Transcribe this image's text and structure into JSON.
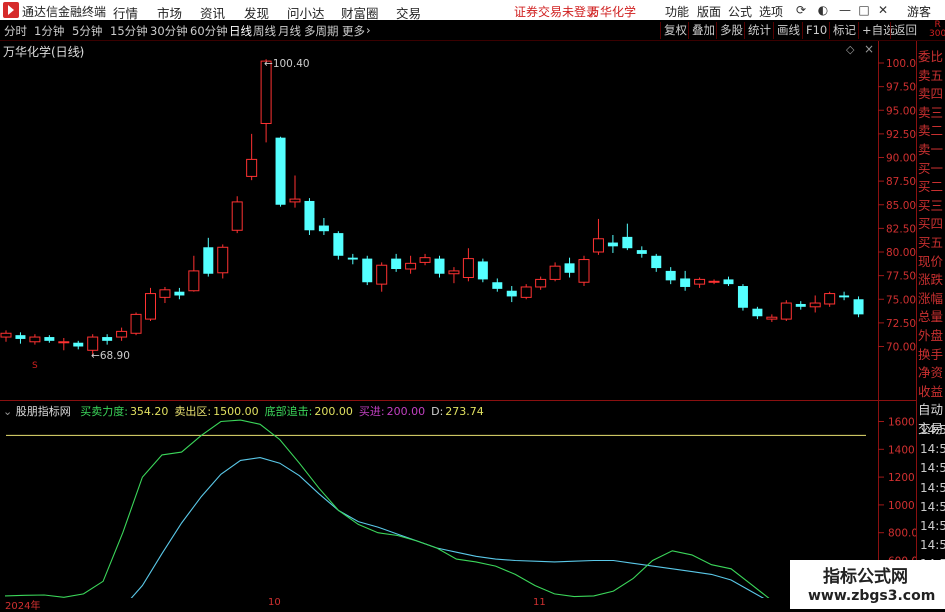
{
  "titlebar": {
    "app_name": "通达信金融终端",
    "menus": [
      "行情",
      "市场",
      "资讯",
      "发现",
      "问小达",
      "财富圈",
      "交易"
    ],
    "status": "证券交易未登录",
    "stock": "万华化学",
    "right_menus": [
      "功能",
      "版面",
      "公式",
      "选项"
    ],
    "user": "游客"
  },
  "toolbar": {
    "periods": [
      "分时",
      "1分钟",
      "5分钟",
      "15分钟",
      "30分钟",
      "60分钟",
      "日线",
      "周线",
      "月线",
      "多周期",
      "更多"
    ],
    "active_period": "日线",
    "right_buttons": [
      "复权",
      "叠加",
      "多股",
      "统计",
      "画线",
      "F10",
      "标记",
      "+自选",
      "返回"
    ]
  },
  "main_chart": {
    "title": "万华化学(日线)",
    "y_ticks": [
      "100.0",
      "97.50",
      "95.00",
      "92.50",
      "90.00",
      "87.50",
      "85.00",
      "82.50",
      "80.00",
      "77.50",
      "75.00",
      "72.50",
      "70.00"
    ],
    "high_label": "100.40",
    "low_label": "68.90",
    "marker": "S",
    "candles": [
      {
        "o": 71.0,
        "c": 71.4,
        "h": 71.7,
        "l": 70.5
      },
      {
        "o": 71.2,
        "c": 70.8,
        "h": 71.5,
        "l": 70.3
      },
      {
        "o": 70.5,
        "c": 71.0,
        "h": 71.3,
        "l": 70.2
      },
      {
        "o": 71.0,
        "c": 70.6,
        "h": 71.2,
        "l": 70.4
      },
      {
        "o": 70.4,
        "c": 70.5,
        "h": 70.9,
        "l": 69.6
      },
      {
        "o": 70.4,
        "c": 70.0,
        "h": 70.6,
        "l": 69.7
      },
      {
        "o": 69.6,
        "c": 71.0,
        "h": 71.3,
        "l": 68.9
      },
      {
        "o": 71.0,
        "c": 70.6,
        "h": 71.3,
        "l": 70.2
      },
      {
        "o": 71.0,
        "c": 71.6,
        "h": 72.0,
        "l": 70.6
      },
      {
        "o": 71.4,
        "c": 73.4,
        "h": 73.6,
        "l": 71.2
      },
      {
        "o": 72.9,
        "c": 75.6,
        "h": 76.2,
        "l": 72.7
      },
      {
        "o": 75.2,
        "c": 76.0,
        "h": 76.3,
        "l": 74.6
      },
      {
        "o": 75.8,
        "c": 75.4,
        "h": 76.2,
        "l": 75.0
      },
      {
        "o": 75.9,
        "c": 78.0,
        "h": 79.6,
        "l": 75.8
      },
      {
        "o": 80.5,
        "c": 77.7,
        "h": 81.5,
        "l": 77.4
      },
      {
        "o": 77.8,
        "c": 80.5,
        "h": 80.8,
        "l": 77.2
      },
      {
        "o": 82.3,
        "c": 85.3,
        "h": 85.9,
        "l": 82.0
      },
      {
        "o": 88.0,
        "c": 89.8,
        "h": 92.5,
        "l": 87.6
      },
      {
        "o": 93.6,
        "c": 100.2,
        "h": 100.4,
        "l": 91.6
      },
      {
        "o": 92.1,
        "c": 85.0,
        "h": 92.2,
        "l": 84.8
      },
      {
        "o": 85.3,
        "c": 85.6,
        "h": 88.1,
        "l": 84.7
      },
      {
        "o": 85.4,
        "c": 82.3,
        "h": 85.7,
        "l": 81.8
      },
      {
        "o": 82.8,
        "c": 82.2,
        "h": 83.6,
        "l": 81.8
      },
      {
        "o": 82.0,
        "c": 79.6,
        "h": 82.2,
        "l": 79.2
      },
      {
        "o": 79.4,
        "c": 79.2,
        "h": 79.8,
        "l": 78.7
      },
      {
        "o": 79.3,
        "c": 76.8,
        "h": 79.6,
        "l": 76.5
      },
      {
        "o": 76.6,
        "c": 78.6,
        "h": 78.9,
        "l": 75.8
      },
      {
        "o": 79.3,
        "c": 78.2,
        "h": 79.8,
        "l": 77.9
      },
      {
        "o": 78.2,
        "c": 78.8,
        "h": 79.6,
        "l": 77.7
      },
      {
        "o": 78.9,
        "c": 79.4,
        "h": 79.8,
        "l": 78.6
      },
      {
        "o": 79.3,
        "c": 77.7,
        "h": 79.6,
        "l": 77.3
      },
      {
        "o": 77.7,
        "c": 78.0,
        "h": 78.4,
        "l": 76.7
      },
      {
        "o": 77.3,
        "c": 79.3,
        "h": 80.4,
        "l": 76.9
      },
      {
        "o": 79.0,
        "c": 77.1,
        "h": 79.3,
        "l": 76.8
      },
      {
        "o": 76.8,
        "c": 76.1,
        "h": 77.2,
        "l": 75.8
      },
      {
        "o": 75.9,
        "c": 75.3,
        "h": 76.4,
        "l": 74.7
      },
      {
        "o": 75.2,
        "c": 76.3,
        "h": 76.6,
        "l": 75.0
      },
      {
        "o": 76.3,
        "c": 77.1,
        "h": 77.4,
        "l": 76.0
      },
      {
        "o": 77.1,
        "c": 78.5,
        "h": 78.9,
        "l": 76.9
      },
      {
        "o": 78.8,
        "c": 77.8,
        "h": 79.4,
        "l": 77.3
      },
      {
        "o": 76.8,
        "c": 79.2,
        "h": 79.6,
        "l": 76.4
      },
      {
        "o": 80.0,
        "c": 81.4,
        "h": 83.5,
        "l": 79.7
      },
      {
        "o": 81.0,
        "c": 80.6,
        "h": 81.8,
        "l": 79.9
      },
      {
        "o": 81.6,
        "c": 80.4,
        "h": 83.0,
        "l": 80.2
      },
      {
        "o": 80.2,
        "c": 79.8,
        "h": 80.6,
        "l": 79.4
      },
      {
        "o": 79.6,
        "c": 78.3,
        "h": 79.8,
        "l": 77.9
      },
      {
        "o": 78.0,
        "c": 77.0,
        "h": 78.4,
        "l": 76.6
      },
      {
        "o": 77.2,
        "c": 76.3,
        "h": 78.0,
        "l": 75.9
      },
      {
        "o": 76.6,
        "c": 77.1,
        "h": 77.3,
        "l": 76.2
      },
      {
        "o": 76.8,
        "c": 76.9,
        "h": 77.1,
        "l": 76.6
      },
      {
        "o": 77.1,
        "c": 76.6,
        "h": 77.4,
        "l": 76.4
      },
      {
        "o": 76.4,
        "c": 74.1,
        "h": 76.6,
        "l": 73.8
      },
      {
        "o": 74.0,
        "c": 73.2,
        "h": 74.2,
        "l": 72.9
      },
      {
        "o": 72.9,
        "c": 73.1,
        "h": 73.4,
        "l": 72.6
      },
      {
        "o": 72.9,
        "c": 74.6,
        "h": 74.9,
        "l": 72.7
      },
      {
        "o": 74.5,
        "c": 74.2,
        "h": 74.8,
        "l": 73.9
      },
      {
        "o": 74.2,
        "c": 74.6,
        "h": 75.4,
        "l": 73.6
      },
      {
        "o": 74.5,
        "c": 75.6,
        "h": 75.8,
        "l": 74.2
      },
      {
        "o": 75.4,
        "c": 75.2,
        "h": 75.8,
        "l": 74.9
      },
      {
        "o": 75.0,
        "c": 73.4,
        "h": 75.3,
        "l": 73.1
      }
    ]
  },
  "right_panel": {
    "labels": [
      "委比",
      "卖五",
      "卖四",
      "卖三",
      "卖二",
      "卖一",
      "买一",
      "买二",
      "买三",
      "买四",
      "买五",
      "现价",
      "涨跌",
      "涨幅",
      "总量",
      "外盘",
      "换手",
      "净资",
      "收益",
      "自动",
      "交易"
    ],
    "times": [
      "14:56",
      "14:56",
      "14:56",
      "14:56",
      "14:56",
      "14:56",
      "14:56",
      "14:56"
    ],
    "r_label": "R",
    "r_value": "300"
  },
  "indicator": {
    "name": "股朋指标网",
    "items": [
      {
        "label": "买卖力度:",
        "value": "354.20",
        "color": "#3bd65a"
      },
      {
        "label": "卖出区:",
        "value": "1500.00",
        "color": "#e8e070"
      },
      {
        "label": "底部追击:",
        "value": "200.00",
        "color": "#3bd65a"
      },
      {
        "label": "买进:",
        "value": "200.00",
        "color": "#c040c0"
      },
      {
        "label": "D:",
        "value": "273.74",
        "color": "#d0d0d0"
      }
    ],
    "y_ticks": [
      "1600",
      "1400",
      "1200",
      "1000",
      "800.00",
      "600.00",
      "400.00"
    ],
    "green_line": [
      345,
      350,
      352,
      335,
      360,
      450,
      800,
      1200,
      1360,
      1380,
      1500,
      1600,
      1610,
      1580,
      1470,
      1300,
      1120,
      960,
      860,
      800,
      780,
      740,
      690,
      610,
      590,
      560,
      500,
      420,
      360,
      340,
      345,
      380,
      470,
      600,
      670,
      640,
      570,
      540,
      430,
      320,
      290
    ],
    "blue_line": [
      190,
      195,
      200,
      205,
      215,
      230,
      260,
      420,
      650,
      870,
      1060,
      1220,
      1320,
      1340,
      1300,
      1210,
      1080,
      960,
      880,
      840,
      790,
      740,
      690,
      660,
      630,
      610,
      600,
      595,
      590,
      595,
      600,
      600,
      580,
      560,
      540,
      520,
      500,
      460,
      380,
      300,
      280
    ]
  },
  "xaxis": {
    "labels": [
      "2024年",
      "10",
      "11"
    ]
  },
  "watermark": {
    "line1": "指标公式网",
    "line2": "www.zbgs3.com"
  }
}
